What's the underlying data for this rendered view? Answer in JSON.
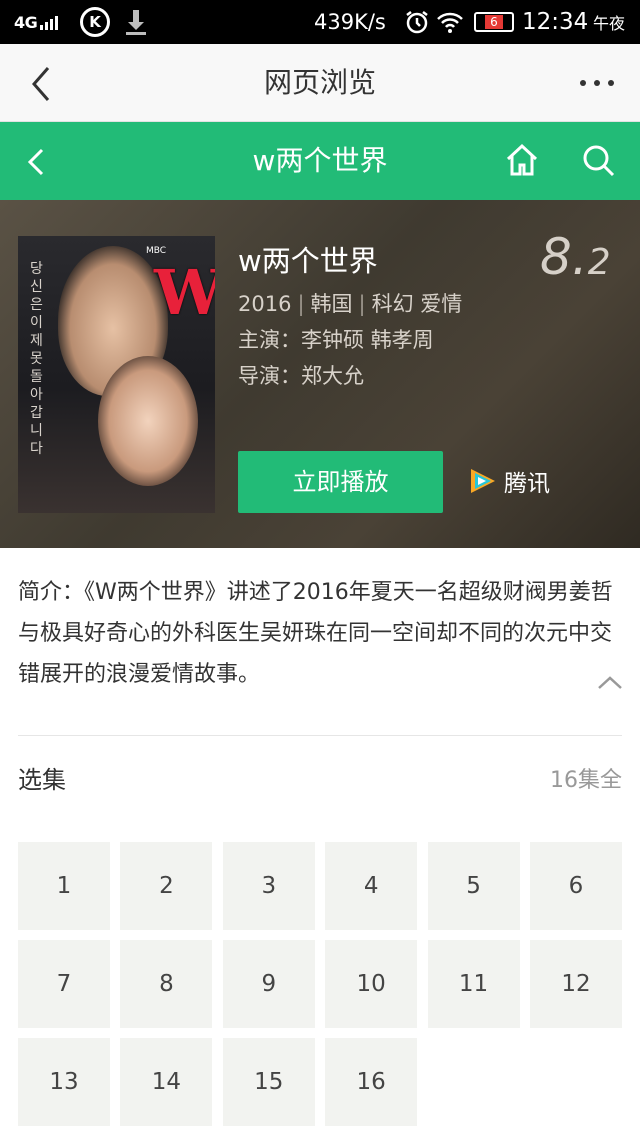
{
  "status_bar": {
    "network": "4G",
    "k_label": "K",
    "speed": "439K/s",
    "battery": "6",
    "time": "12:34",
    "period": "午夜"
  },
  "browser_header": {
    "title": "网页浏览",
    "back_icon": "chevron-left-icon",
    "more_icon": "more-dots-icon"
  },
  "nav": {
    "title": "w两个世界",
    "back_icon": "chevron-left-icon",
    "home_icon": "home-icon",
    "search_icon": "search-icon",
    "color": "#22bb77"
  },
  "movie": {
    "title": "w两个世界",
    "score_int": "8.",
    "score_dec": "2",
    "year": "2016",
    "region": "韩国",
    "genre": "科幻 爱情",
    "cast": "主演：李钟硕 韩孝周",
    "director": "导演：郑大允",
    "play_label": "立即播放",
    "source": "腾讯",
    "poster": {
      "logo_text": "W",
      "broadcaster": "MBC",
      "vertical_text": "당신은 이제 못 돌아 갑니다"
    }
  },
  "intro": {
    "text": "简介：《W两个世界》讲述了2016年夏天一名超级财阀男姜哲与极具好奇心的外科医生吴妍珠在同一空间却不同的次元中交错展开的浪漫爱情故事。"
  },
  "episodes": {
    "label": "选集",
    "count_label": "16集全",
    "items": [
      "1",
      "2",
      "3",
      "4",
      "5",
      "6",
      "7",
      "8",
      "9",
      "10",
      "11",
      "12",
      "13",
      "14",
      "15",
      "16"
    ]
  }
}
